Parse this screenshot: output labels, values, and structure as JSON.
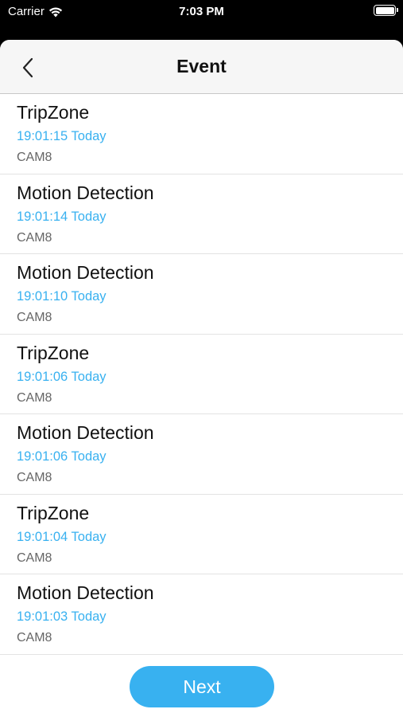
{
  "status_bar": {
    "carrier": "Carrier",
    "time": "7:03 PM"
  },
  "nav": {
    "title": "Event",
    "back_icon": "chevron-left-icon"
  },
  "events": [
    {
      "type": "TripZone",
      "time": "19:01:15 Today",
      "camera": "CAM8"
    },
    {
      "type": "Motion Detection",
      "time": "19:01:14 Today",
      "camera": "CAM8"
    },
    {
      "type": "Motion Detection",
      "time": "19:01:10 Today",
      "camera": "CAM8"
    },
    {
      "type": "TripZone",
      "time": "19:01:06 Today",
      "camera": "CAM8"
    },
    {
      "type": "Motion Detection",
      "time": "19:01:06 Today",
      "camera": "CAM8"
    },
    {
      "type": "TripZone",
      "time": "19:01:04 Today",
      "camera": "CAM8"
    },
    {
      "type": "Motion Detection",
      "time": "19:01:03 Today",
      "camera": "CAM8"
    }
  ],
  "next_button_label": "Next",
  "colors": {
    "accent": "#38b1f0",
    "nav_background": "#f6f6f6"
  }
}
